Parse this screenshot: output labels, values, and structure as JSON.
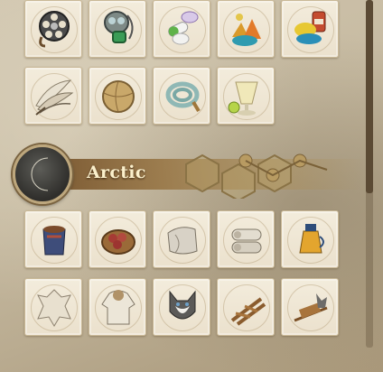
{
  "section": {
    "title": "Arctic",
    "emblem_icon": "crescent-moon-icon"
  },
  "rows": [
    {
      "items": [
        "film-reel-icon",
        "gas-mask-icon",
        "pills-icon",
        "colored-powder-icon",
        "paint-pigments-icon"
      ]
    },
    {
      "items": [
        "feathers-icon",
        "leather-ball-icon",
        "coiled-hose-icon",
        "lemonade-glass-icon"
      ]
    },
    {
      "items": [
        "clay-jar-icon",
        "meatballs-bowl-icon",
        "fur-pelt-roll-icon",
        "rolled-pelts-icon",
        "oil-lamp-icon"
      ]
    },
    {
      "items": [
        "animal-hide-icon",
        "parka-icon",
        "husky-dog-icon",
        "wooden-sled-icon",
        "dog-sled-icon"
      ]
    }
  ],
  "scrollbar": {
    "position": 0.0
  }
}
